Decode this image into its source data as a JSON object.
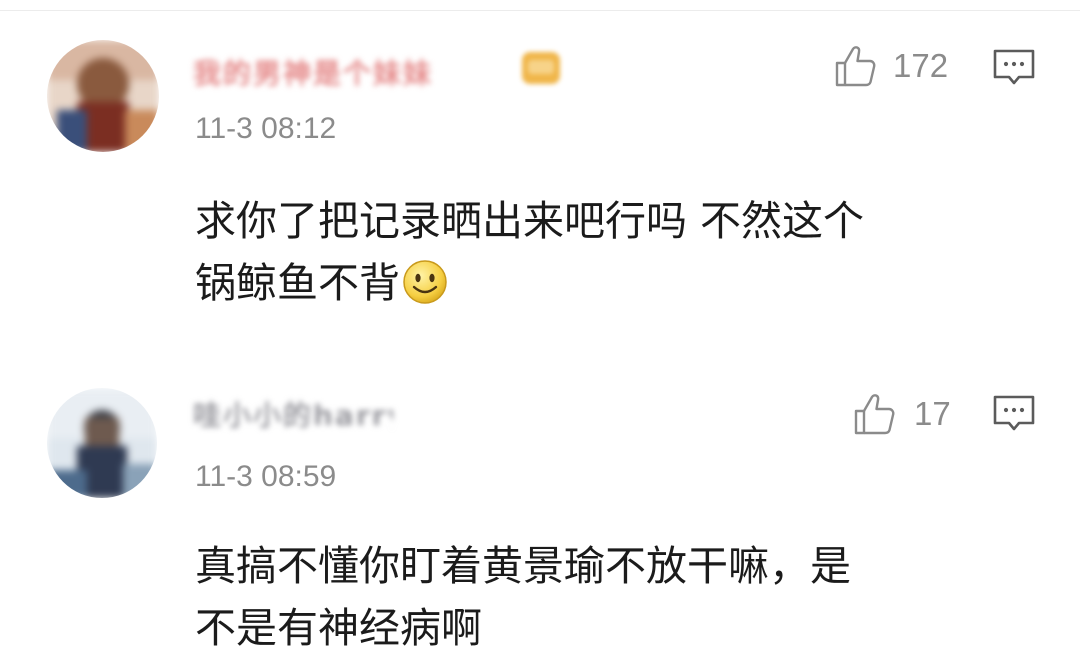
{
  "comments": [
    {
      "username": "我的男神是个妹妹",
      "time": "11-3 08:12",
      "likes": "172",
      "content_lines": [
        "求你了把记录晒出来吧行吗 不然这个",
        "锅鲸鱼不背"
      ],
      "emoji": "smile-emoji-icon"
    },
    {
      "username": "哇小小的harry",
      "time": "11-3 08:59",
      "likes": "17",
      "content_lines": [
        "真搞不懂你盯着黄景瑜不放干嘛，是",
        "不是有神经病啊"
      ]
    }
  ],
  "colors": {
    "text": "#1b1b1b",
    "muted": "#8b8b8b",
    "username_pink": "#e58a8a",
    "divider": "#ececec"
  }
}
